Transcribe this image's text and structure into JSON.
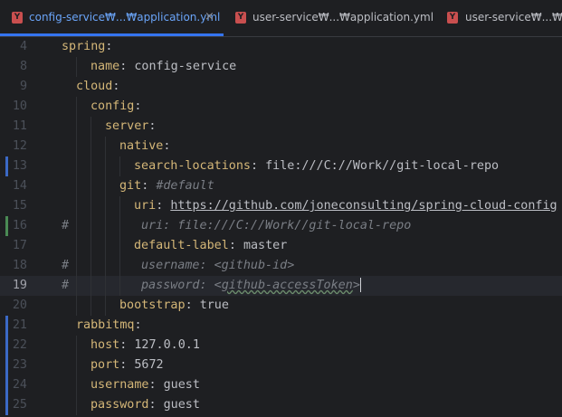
{
  "tabs": [
    {
      "label": "config-service₩...₩application.yml",
      "active": true,
      "close": "×"
    },
    {
      "label": "user-service₩...₩application.yml",
      "active": false
    },
    {
      "label": "user-service₩...₩boo",
      "active": false
    }
  ],
  "file_icon_letter": "Y",
  "colors": {
    "accent": "#3574f0",
    "key": "#d5b778",
    "comment": "#7a7e85",
    "text": "#bcbec4",
    "file_icon": "#c94f4f"
  },
  "lines": [
    {
      "n": "4",
      "key": "spring",
      "sep": ":",
      "val": ""
    },
    {
      "n": "8",
      "key": "name",
      "sep": ": ",
      "val": "config-service"
    },
    {
      "n": "9",
      "key": "cloud",
      "sep": ":",
      "val": ""
    },
    {
      "n": "10",
      "key": "config",
      "sep": ":",
      "val": ""
    },
    {
      "n": "11",
      "key": "server",
      "sep": ":",
      "val": ""
    },
    {
      "n": "12",
      "key": "native",
      "sep": ":",
      "val": ""
    },
    {
      "n": "13",
      "key": "search-locations",
      "sep": ": ",
      "val": "file:///C://Work//git-local-repo"
    },
    {
      "n": "14",
      "key": "git",
      "sep": ": ",
      "comment": "#default"
    },
    {
      "n": "15",
      "key": "uri",
      "sep": ": ",
      "url": "https://github.com/joneconsulting/spring-cloud-config"
    },
    {
      "n": "16",
      "hash": "#",
      "comment": "uri: file:///C://Work//git-local-repo"
    },
    {
      "n": "17",
      "key": "default-label",
      "sep": ": ",
      "val": "master"
    },
    {
      "n": "18",
      "hash": "#",
      "comment": "username: <github-id>"
    },
    {
      "n": "19",
      "hash": "#",
      "comment_pre": "password: <",
      "comment_squig": "github-accessToken",
      "comment_post": ">"
    },
    {
      "n": "20",
      "key": "bootstrap",
      "sep": ": ",
      "val": "true"
    },
    {
      "n": "21",
      "key": "rabbitmq",
      "sep": ":",
      "val": ""
    },
    {
      "n": "22",
      "key": "host",
      "sep": ": ",
      "val": "127.0.0.1"
    },
    {
      "n": "23",
      "key": "port",
      "sep": ": ",
      "val": "5672"
    },
    {
      "n": "24",
      "key": "username",
      "sep": ": ",
      "val": "guest"
    },
    {
      "n": "25",
      "key": "password",
      "sep": ": ",
      "val": "guest"
    }
  ]
}
